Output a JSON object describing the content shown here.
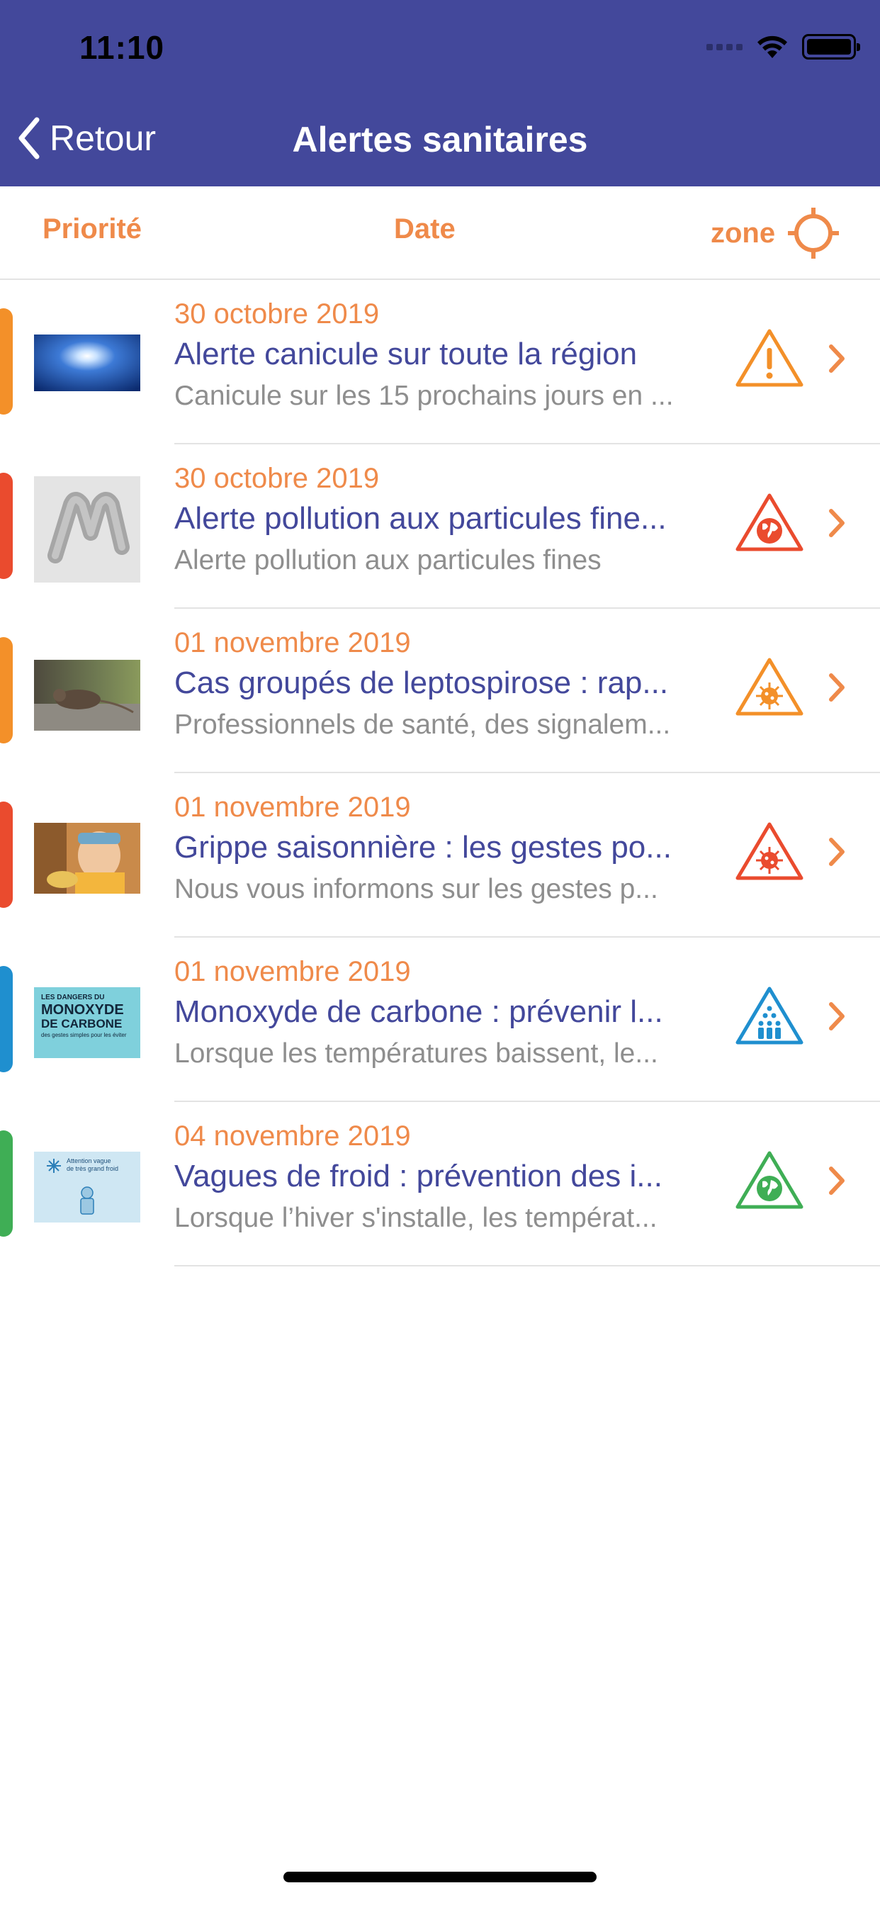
{
  "status_bar": {
    "time": "11:10"
  },
  "nav": {
    "back_label": "Retour",
    "title": "Alertes sanitaires"
  },
  "sort": {
    "priority": "Priorité",
    "date": "Date",
    "zone": "zone"
  },
  "colors": {
    "header": "#43489b",
    "accent": "#ef8a4a",
    "title_text": "#43489b",
    "subtitle_text": "#8e8e8e",
    "priority_orange": "#f39029",
    "priority_red": "#ea4b2e",
    "priority_blue": "#1f8fcf",
    "priority_green": "#3fae55"
  },
  "alerts": [
    {
      "date": "30 octobre 2019",
      "title": "Alerte canicule sur toute la région",
      "subtitle": "Canicule sur les 15 prochains jours en ...",
      "icon": "warning-triangle-icon"
    },
    {
      "date": "30 octobre 2019",
      "title": "Alerte pollution aux particules fine...",
      "subtitle": "Alerte pollution aux particules fines",
      "icon": "globe-triangle-icon"
    },
    {
      "date": "01 novembre 2019",
      "title": "Cas groupés de leptospirose : rap...",
      "subtitle": "Professionnels de santé, des signalem...",
      "icon": "virus-triangle-icon"
    },
    {
      "date": "01 novembre 2019",
      "title": "Grippe saisonnière : les gestes po...",
      "subtitle": "Nous vous informons sur les gestes p...",
      "icon": "virus-triangle-icon"
    },
    {
      "date": "01 novembre 2019",
      "title": "Monoxyde de carbone : prévenir l...",
      "subtitle": "Lorsque les températures baissent, le...",
      "icon": "crowd-triangle-icon"
    },
    {
      "date": "04 novembre 2019",
      "title": "Vagues de froid : prévention des i...",
      "subtitle": "Lorsque l’hiver s'installe, les températ...",
      "icon": "globe-triangle-icon"
    }
  ],
  "thumbnails": {
    "carbon_monoxide": {
      "line1": "LES DANGERS DU",
      "line2": "MONOXYDE",
      "line3": "DE CARBONE",
      "line4": "des gestes simples pour les éviter"
    },
    "cold_wave": {
      "line1": "Attention vague",
      "line2": "de très grand froid"
    }
  }
}
